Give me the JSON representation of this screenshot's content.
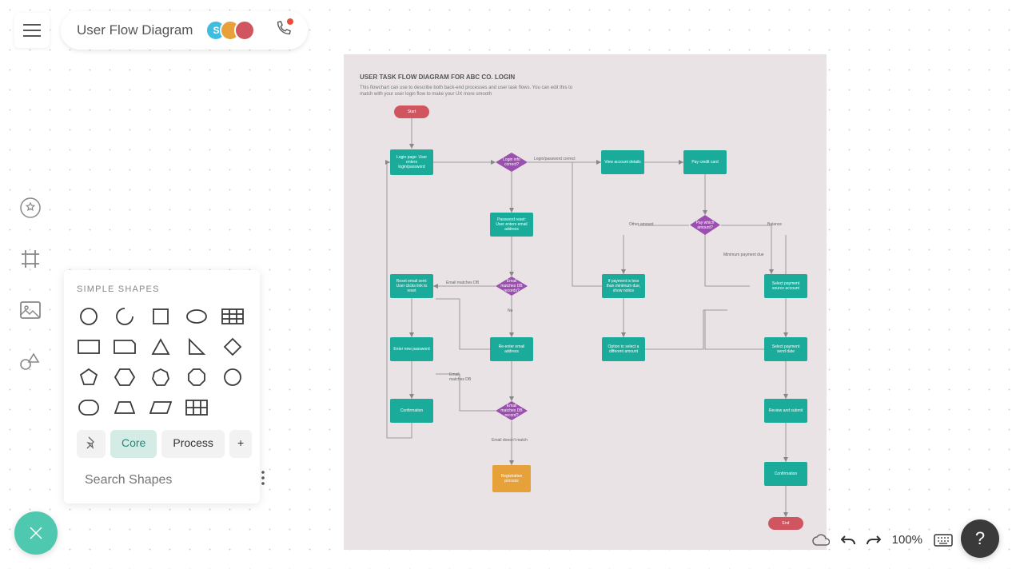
{
  "header": {
    "title": "User Flow Diagram",
    "avatars": [
      {
        "label": "S",
        "bg": "#3fbce0"
      },
      {
        "label": "",
        "bg": "#e8a13a"
      },
      {
        "label": "",
        "bg": "#d15560"
      }
    ]
  },
  "shapes_panel": {
    "label": "SIMPLE SHAPES",
    "tabs": {
      "pin": "",
      "core": "Core",
      "process": "Process",
      "add": "+"
    },
    "search_placeholder": "Search Shapes"
  },
  "canvas": {
    "title": "USER TASK FLOW DIAGRAM FOR ABC CO. LOGIN",
    "description": "This flowchart can use to describe both back-end processes and user task flows. You can edit this to match with your user login flow to make your UX more smooth",
    "nodes": {
      "start": "Start",
      "login_page": "Login page: User enters login/password",
      "login_valid": "Login info correct?",
      "login_correct_label": "Login/password correct",
      "view_account": "View account details",
      "pay_credit": "Pay credit card",
      "pwd_reset": "Password reset: User enters email address",
      "email_matches": "Email matches DB records?",
      "email_matches_label": "Email matches DB",
      "no_label": "No",
      "reset_sent": "Reset email sent: User clicks link to reset",
      "enter_new_pwd": "Enter new password",
      "reenter_email": "Re-enter email address",
      "email_matches_db2": "Email matches DB record?",
      "email_no_match": "Email doesn't match",
      "reg_process": "Registration process",
      "email_matches_db_label": "Email matches DB",
      "confirmation": "Confirmation",
      "pay_which": "Pay which amount?",
      "other_amount": "Other amount",
      "balance": "Balance",
      "minimum_payment": "Minimum payment due",
      "if_less": "If payment is less than minimum due, show notice",
      "option_select": "Option to select a different amount",
      "select_payment_acct": "Select payment source account",
      "select_payment_date": "Select payment send date",
      "review_submit": "Review and submit",
      "confirmation2": "Confirmation",
      "end": "End"
    }
  },
  "controls": {
    "zoom": "100%"
  },
  "colors": {
    "process": "#1aab9b",
    "decision": "#9b4fae",
    "terminal": "#d15560",
    "action": "#e7a13a",
    "accent": "#4ec9b0"
  }
}
